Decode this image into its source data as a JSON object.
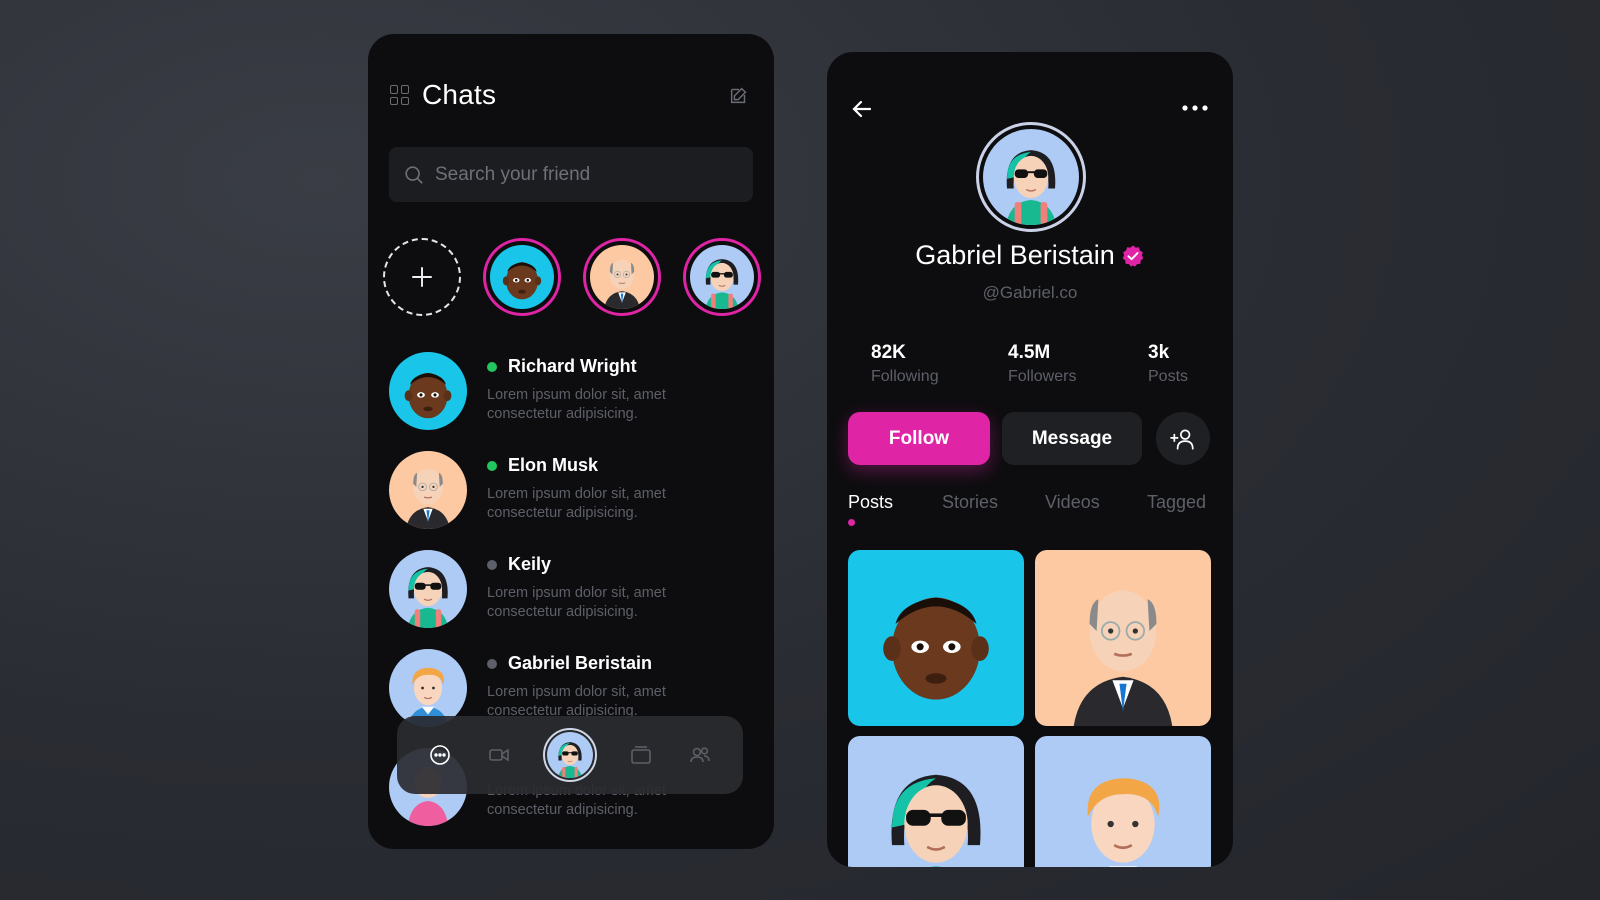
{
  "colors": {
    "accent": "#e024a6",
    "online": "#22c55e",
    "offline": "#5d6068",
    "panel_bg": "#0d0d0f",
    "input_bg": "#1c1d21"
  },
  "chats": {
    "title": "Chats",
    "search": {
      "placeholder": "Search your friend",
      "value": ""
    },
    "stories": [
      "Richard Wright",
      "Elon Musk",
      "Keily"
    ],
    "list": [
      {
        "name": "Richard Wright",
        "message": "Lorem ipsum dolor sit, amet consectetur adipisicing.",
        "status": "online"
      },
      {
        "name": "Elon Musk",
        "message": "Lorem ipsum dolor sit, amet consectetur adipisicing.",
        "status": "online"
      },
      {
        "name": "Keily",
        "message": "Lorem ipsum dolor sit, amet consectetur adipisicing.",
        "status": "offline"
      },
      {
        "name": "Gabriel Beristain",
        "message": "Lorem ipsum dolor sit, amet consectetur adipisicing.",
        "status": "offline"
      },
      {
        "name": "",
        "message": "Lorem ipsum dolor sit, amet consectetur adipisicing.",
        "status": "offline"
      }
    ],
    "bottom_nav": [
      "chat-bubble-icon",
      "video-camera-icon",
      "profile-avatar",
      "wallet-icon",
      "users-icon"
    ]
  },
  "profile": {
    "name": "Gabriel Beristain",
    "handle": "@Gabriel.co",
    "stats": [
      {
        "value": "82K",
        "label": "Following"
      },
      {
        "value": "4.5M",
        "label": "Followers"
      },
      {
        "value": "3k",
        "label": "Posts"
      }
    ],
    "follow_label": "Follow",
    "message_label": "Message",
    "tabs": [
      "Posts",
      "Stories",
      "Videos",
      "Tagged"
    ],
    "active_tab": "Posts"
  }
}
